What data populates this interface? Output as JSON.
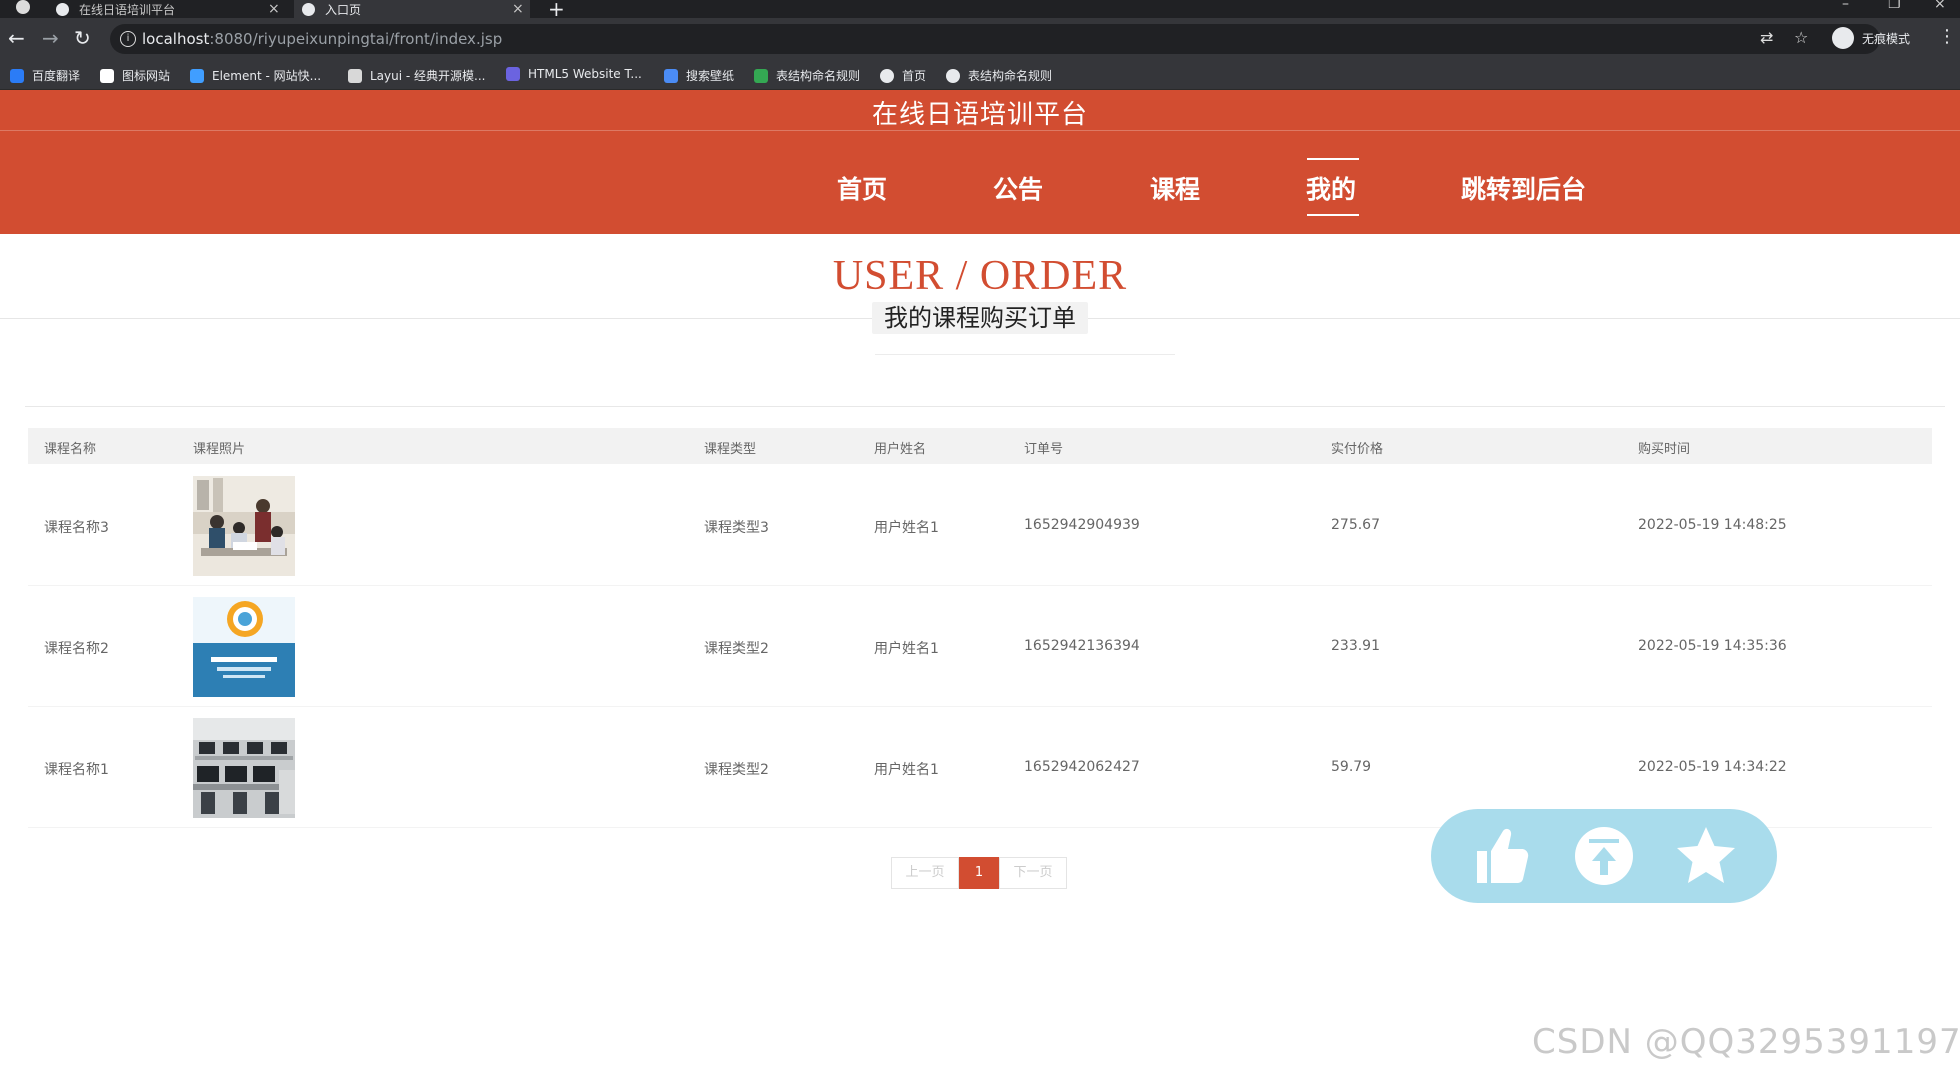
{
  "browser": {
    "tabs": [
      {
        "title": "在线日语培训平台"
      },
      {
        "title": "入口页"
      }
    ],
    "url_host": "localhost",
    "url_rest": ":8080/riyupeixunpingtai/front/index.jsp",
    "profile_label": "无痕模式",
    "bookmarks": [
      {
        "label": "百度翻译",
        "color": "#2b7cf6"
      },
      {
        "label": "图标网站",
        "color": "#ffffff"
      },
      {
        "label": "Element - 网站快...",
        "color": "#409eff"
      },
      {
        "label": "Layui - 经典开源模...",
        "color": "#d8d8d8"
      },
      {
        "label": "HTML5 Website T...",
        "color": "#6b63e0"
      },
      {
        "label": "搜索壁纸",
        "color": "#4b8cf5"
      },
      {
        "label": "表结构命名规则",
        "color": "#34a853"
      },
      {
        "label": "首页",
        "color": "#e8eaed"
      },
      {
        "label": "表结构命名规则",
        "color": "#e8eaed"
      }
    ]
  },
  "site": {
    "title": "在线日语培训平台",
    "nav": [
      "首页",
      "公告",
      "课程",
      "我的",
      "跳转到后台"
    ],
    "active_nav": "我的",
    "accent_color": "#d24d31"
  },
  "section": {
    "title": "USER / ORDER",
    "subtitle": "我的课程购买订单"
  },
  "table": {
    "headers": [
      "课程名称",
      "课程照片",
      "课程类型",
      "用户姓名",
      "订单号",
      "实付价格",
      "购买时间"
    ],
    "rows": [
      {
        "name": "课程名称3",
        "photo": "classroom-students-image",
        "type": "课程类型3",
        "user": "用户姓名1",
        "order_no": "1652942904939",
        "price": "275.67",
        "time": "2022-05-19 14:48:25"
      },
      {
        "name": "课程名称2",
        "photo": "book-cover-image",
        "type": "课程类型2",
        "user": "用户姓名1",
        "order_no": "1652942136394",
        "price": "233.91",
        "time": "2022-05-19 14:35:36"
      },
      {
        "name": "课程名称1",
        "photo": "computer-lab-image",
        "type": "课程类型2",
        "user": "用户姓名1",
        "order_no": "1652942062427",
        "price": "59.79",
        "time": "2022-05-19 14:34:22"
      }
    ]
  },
  "pagination": {
    "prev": "上一页",
    "current": "1",
    "next": "下一页"
  },
  "float_actions": [
    "thumbs-up-icon",
    "back-to-top-icon",
    "star-icon"
  ],
  "watermark": "CSDN @QQ3295391197"
}
